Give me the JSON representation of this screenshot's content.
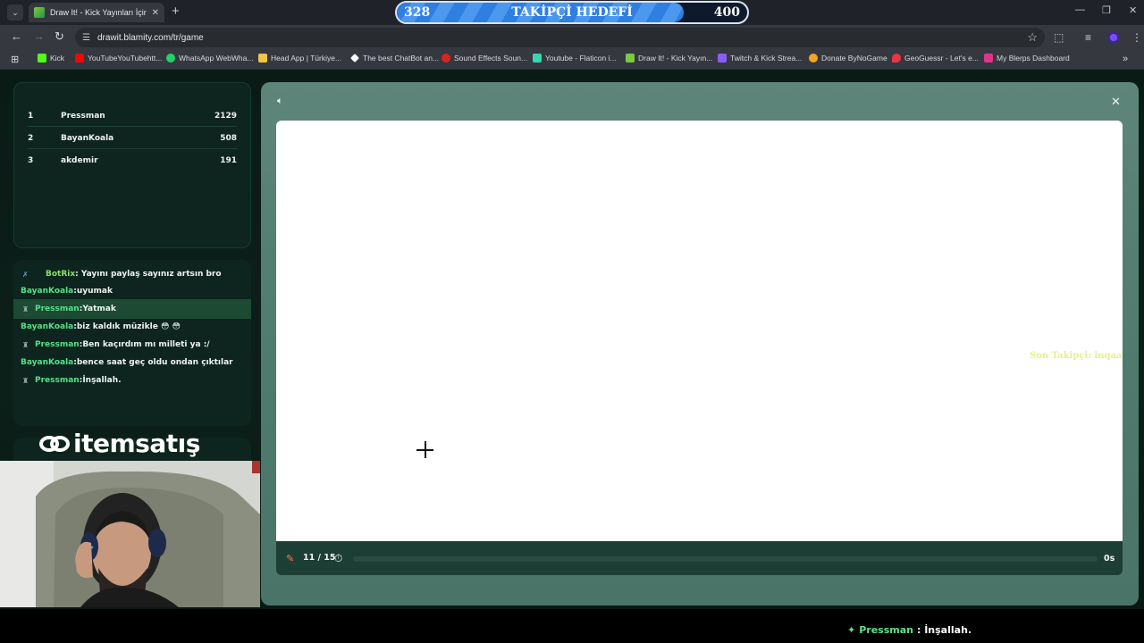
{
  "browser": {
    "tab_title": "Draw It! - Kick Yayınları İçin Çizim",
    "url": "drawit.blamity.com/tr/game",
    "bookmarks": [
      {
        "label": "Kick",
        "color": "#53fc18"
      },
      {
        "label": "YouTubeYouTubehtt...",
        "color": "#ff0000"
      },
      {
        "label": "WhatsApp WebWha...",
        "color": "#25d366"
      },
      {
        "label": "Head App | Türkiye...",
        "color": "#f4c542"
      },
      {
        "label": "The best ChatBot an...",
        "color": "#ffffff"
      },
      {
        "label": "Sound Effects Soun...",
        "color": "#d22"
      },
      {
        "label": "Youtube - Flaticon i...",
        "color": "#38d6b0"
      },
      {
        "label": "Draw It! - Kick Yayın...",
        "color": "#7acb3f"
      },
      {
        "label": "Twitch & Kick Strea...",
        "color": "#8b5cf6"
      },
      {
        "label": "Donate ByNoGame",
        "color": "#f5a623"
      },
      {
        "label": "GeoGuessr - Let's e...",
        "color": "#e34"
      },
      {
        "label": "My Blerps Dashboard",
        "color": "#e0338a"
      }
    ]
  },
  "follower_goal": {
    "current": "328",
    "title": "TAKİPÇİ HEDEFİ",
    "target": "400",
    "progress": 0.82
  },
  "leaderboard": [
    {
      "rank": "1",
      "name": "Pressman",
      "score": "2129"
    },
    {
      "rank": "2",
      "name": "BayanKoala",
      "score": "508"
    },
    {
      "rank": "3",
      "name": "akdemir",
      "score": "191"
    }
  ],
  "chat": [
    {
      "user": "BotRix",
      "text": ": Yayını paylaş sayınız artsın bro",
      "type": "bot"
    },
    {
      "user": "BayanKoala",
      "text": ":uyumak",
      "type": "plain"
    },
    {
      "user": "Pressman",
      "text": ":Yatmak",
      "type": "badge",
      "highlight": true
    },
    {
      "user": "BayanKoala",
      "text": ":biz kaldık müzikle 😳 😳",
      "type": "plain"
    },
    {
      "user": "Pressman",
      "text": ":Ben kaçırdım mı milleti ya :/",
      "type": "badge"
    },
    {
      "user": "BayanKoala",
      "text": ":bence saat geç oldu ondan çıktılar",
      "type": "plain"
    },
    {
      "user": "Pressman",
      "text": ":İnşallah.",
      "type": "badge"
    }
  ],
  "sponsor": {
    "name": "itemsatış"
  },
  "game": {
    "round": "11 / 15",
    "timer": "0s",
    "timer_progress": 0.0,
    "last_follower": "Son Takipçi: inqaaba"
  },
  "ticker": {
    "user": "Pressman",
    "text": ": İnşallah."
  }
}
